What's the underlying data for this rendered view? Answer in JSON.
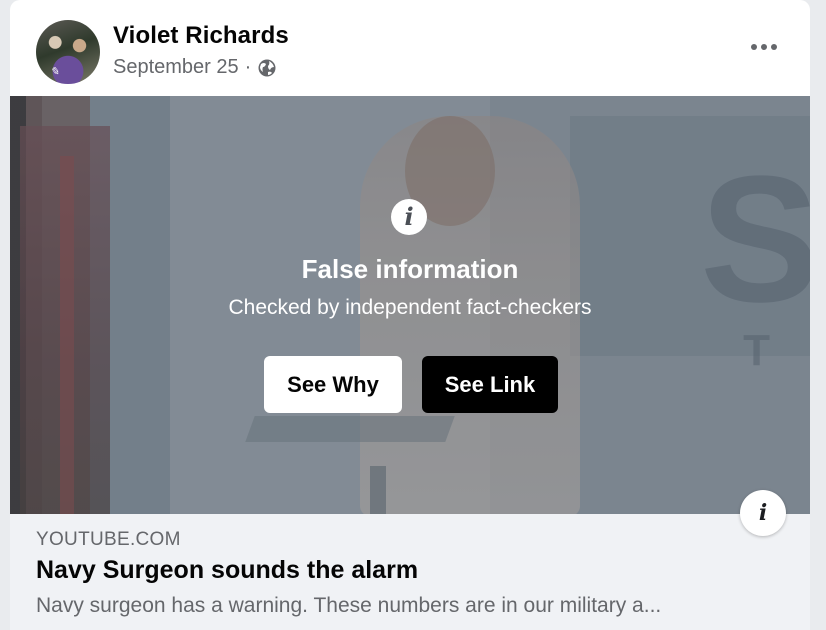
{
  "post": {
    "author": "Violet Richards",
    "date": "September 25",
    "separator": "·",
    "privacy_icon": "globe-icon",
    "more_icon": "more-dots-icon"
  },
  "warning": {
    "icon": "info-icon",
    "title": "False information",
    "subtitle": "Checked by independent fact-checkers",
    "see_why_label": "See Why",
    "see_link_label": "See Link"
  },
  "link_preview": {
    "domain": "YOUTUBE.COM",
    "title": "Navy Surgeon sounds the alarm",
    "description": "Navy surgeon has a warning. These numbers are in our military a...",
    "info_icon": "info-icon"
  },
  "colors": {
    "see_why_bg": "#ffffff",
    "see_link_bg": "#000000",
    "preview_bg": "#f0f2f5",
    "secondary_text": "#65676b"
  }
}
